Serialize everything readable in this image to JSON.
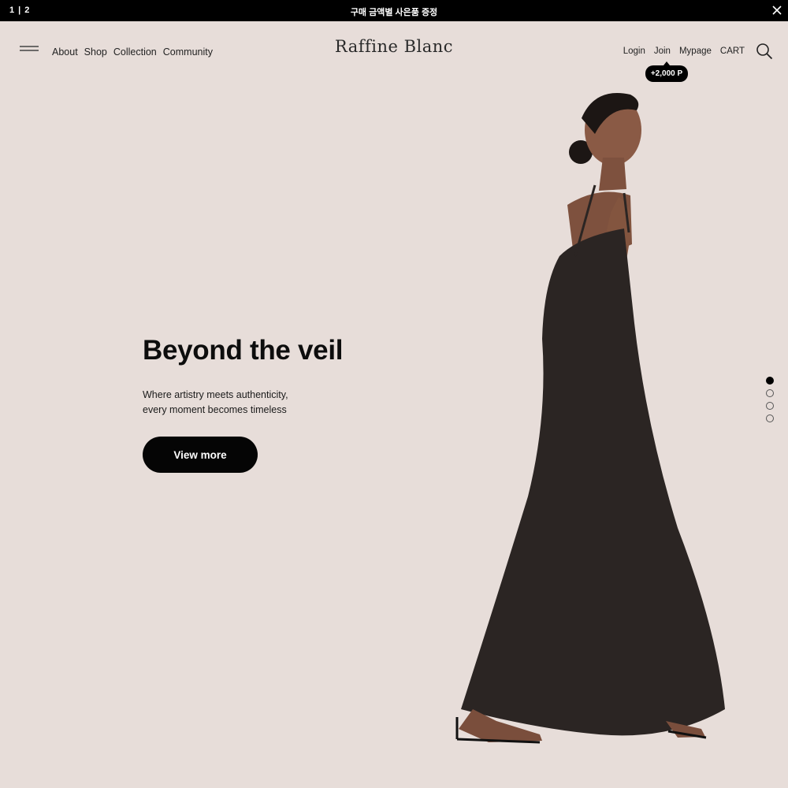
{
  "announcement": {
    "counter": "1 | 2",
    "text": "구매 금액별 사은품 증정"
  },
  "header": {
    "nav": [
      "About",
      "Shop",
      "Collection",
      "Community"
    ],
    "logo": "Raffine Blanc",
    "util": [
      "Login",
      "Join",
      "Mypage",
      "CART"
    ],
    "points_badge": "+2,000 P"
  },
  "hero": {
    "title": "Beyond the veil",
    "subtitle_line1": "Where artistry meets authenticity,",
    "subtitle_line2": "every moment becomes timeless",
    "button": "View more"
  },
  "slider": {
    "total": 4,
    "active_index": 0
  },
  "colors": {
    "background": "#e7ddd9",
    "topbar": "#000000",
    "button": "#050505",
    "dress": "#2b2523"
  },
  "icons": [
    "close-icon",
    "menu-icon",
    "search-icon"
  ]
}
